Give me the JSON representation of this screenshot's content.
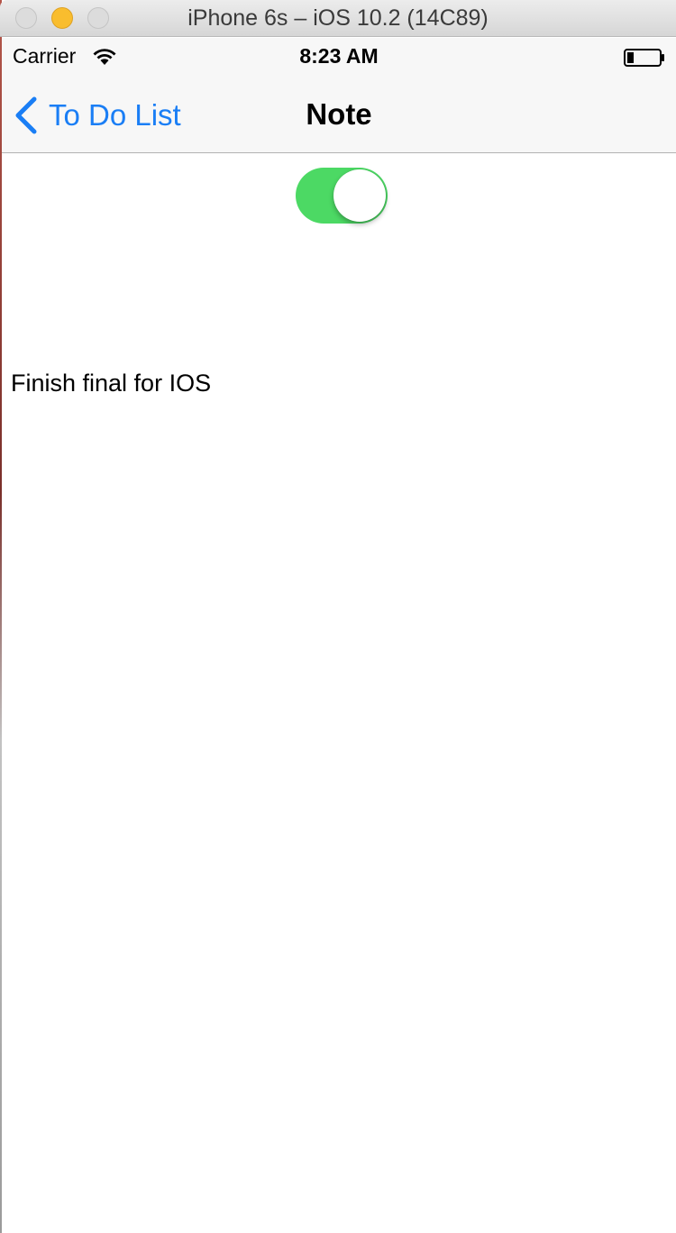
{
  "window": {
    "title": "iPhone 6s – iOS 10.2 (14C89)"
  },
  "status_bar": {
    "carrier": "Carrier",
    "time": "8:23 AM",
    "wifi_icon": "wifi-icon",
    "battery_icon": "battery-icon"
  },
  "nav_bar": {
    "back_label": "To Do List",
    "back_icon": "chevron-left-icon",
    "title": "Note",
    "accent_color": "#1a7ef5"
  },
  "content": {
    "toggle": {
      "on": true,
      "color": "#4cd964"
    },
    "note_text": "Finish final for IOS"
  }
}
